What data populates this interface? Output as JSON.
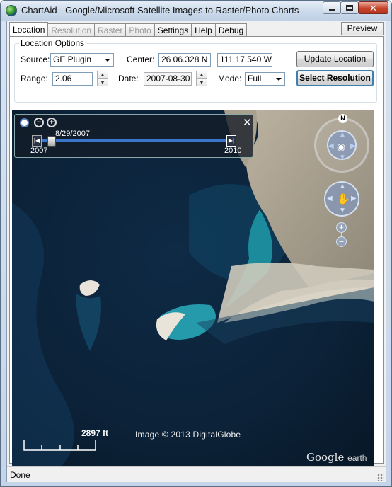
{
  "window": {
    "title": "ChartAid - Google/Microsoft Satellite Images to Raster/Photo Charts",
    "controls": {
      "close_glyph": "✕"
    }
  },
  "tabs": [
    {
      "label": "Location",
      "active": true,
      "enabled": true
    },
    {
      "label": "Resolution",
      "active": false,
      "enabled": false
    },
    {
      "label": "Raster",
      "active": false,
      "enabled": false
    },
    {
      "label": "Photo",
      "active": false,
      "enabled": false
    },
    {
      "label": "Settings",
      "active": false,
      "enabled": true
    },
    {
      "label": "Help",
      "active": false,
      "enabled": true
    },
    {
      "label": "Debug",
      "active": false,
      "enabled": true
    }
  ],
  "preview_button": "Preview",
  "location_options": {
    "group_title": "Location Options",
    "source_label": "Source:",
    "source_value": "GE Plugin",
    "center_label": "Center:",
    "center_lat": "26 06.328 N",
    "center_lon": "111 17.540 W",
    "update_button": "Update Location",
    "range_label": "Range:",
    "range_value": "2.06",
    "date_label": "Date:",
    "date_value": "2007-08-30",
    "mode_label": "Mode:",
    "mode_value": "Full",
    "select_resolution_button": "Select Resolution"
  },
  "map": {
    "timeslider": {
      "current": "8/29/2007",
      "start_year": "2007",
      "end_year": "2010",
      "close_glyph": "✕",
      "position": 0.04
    },
    "compass_north": "N",
    "copyright": "Image © 2013 DigitalGlobe",
    "scale_label": "2897 ft",
    "logo": {
      "google": "Google",
      "earth": "earth"
    }
  },
  "status": {
    "text": "Done"
  },
  "colors": {
    "accent": "#3c7fb1",
    "timeline": "#3a76c9",
    "close": "#c7432b"
  }
}
